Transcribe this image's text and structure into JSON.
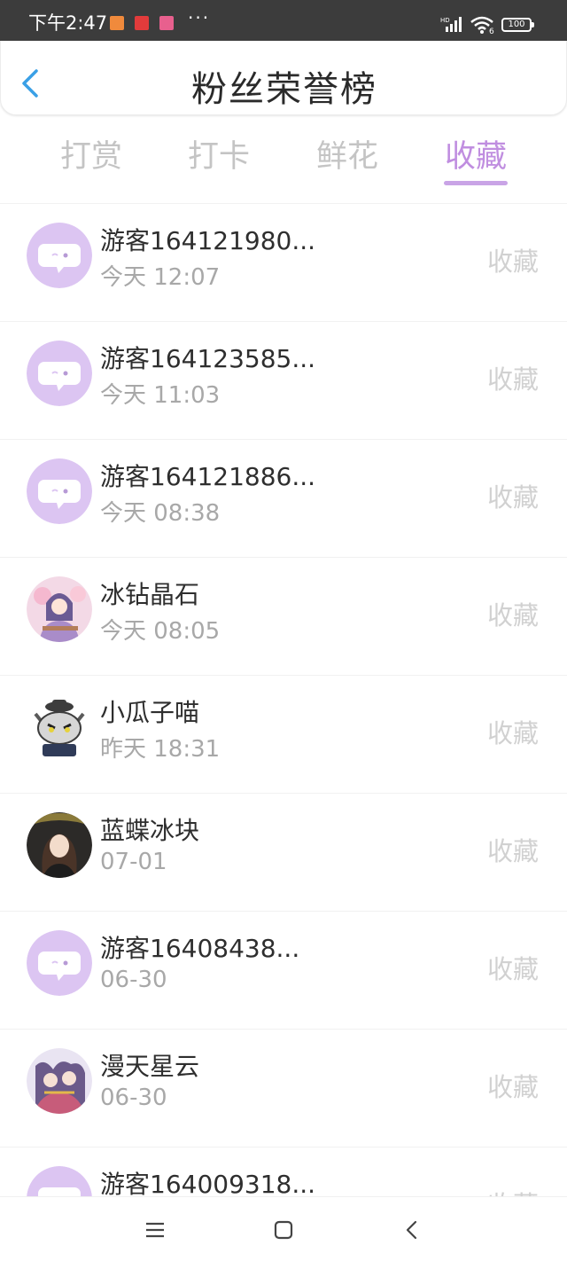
{
  "status_bar": {
    "time": "下午2:47",
    "more": "···",
    "battery": "100",
    "network_label": "HD",
    "wifi_label": "6"
  },
  "header": {
    "title": "粉丝荣誉榜",
    "back_icon": "chevron-left-icon"
  },
  "tabs": [
    {
      "label": "打赏",
      "active": false
    },
    {
      "label": "打卡",
      "active": false
    },
    {
      "label": "鲜花",
      "active": false
    },
    {
      "label": "收藏",
      "active": true
    }
  ],
  "colors": {
    "accent": "#c08ee0",
    "avatar_default": "#dcc5f2",
    "inactive_text": "#c4c4c4",
    "status_bar": "#3c3c3c"
  },
  "list": [
    {
      "name": "游客164121980...",
      "time": "今天 12:07",
      "action": "收藏",
      "avatar": "default-chat-avatar"
    },
    {
      "name": "游客164123585...",
      "time": "今天 11:03",
      "action": "收藏",
      "avatar": "default-chat-avatar"
    },
    {
      "name": "游客164121886...",
      "time": "今天 08:38",
      "action": "收藏",
      "avatar": "default-chat-avatar"
    },
    {
      "name": "冰钻晶石",
      "time": "今天 08:05",
      "action": "收藏",
      "avatar": "photo-avatar-girl"
    },
    {
      "name": "小瓜子喵",
      "time": "昨天 18:31",
      "action": "收藏",
      "avatar": "photo-avatar-cat"
    },
    {
      "name": "蓝蝶冰块",
      "time": "07-01",
      "action": "收藏",
      "avatar": "photo-avatar-dark"
    },
    {
      "name": "游客16408438...",
      "time": "06-30",
      "action": "收藏",
      "avatar": "default-chat-avatar"
    },
    {
      "name": "漫天星云",
      "time": "06-30",
      "action": "收藏",
      "avatar": "photo-avatar-anime"
    },
    {
      "name": "游客164009318...",
      "time": "",
      "action": "收藏",
      "avatar": "default-chat-avatar"
    }
  ],
  "bottom_nav": {
    "menu_icon": "menu-icon",
    "home_icon": "home-square-icon",
    "back_icon": "back-icon"
  }
}
